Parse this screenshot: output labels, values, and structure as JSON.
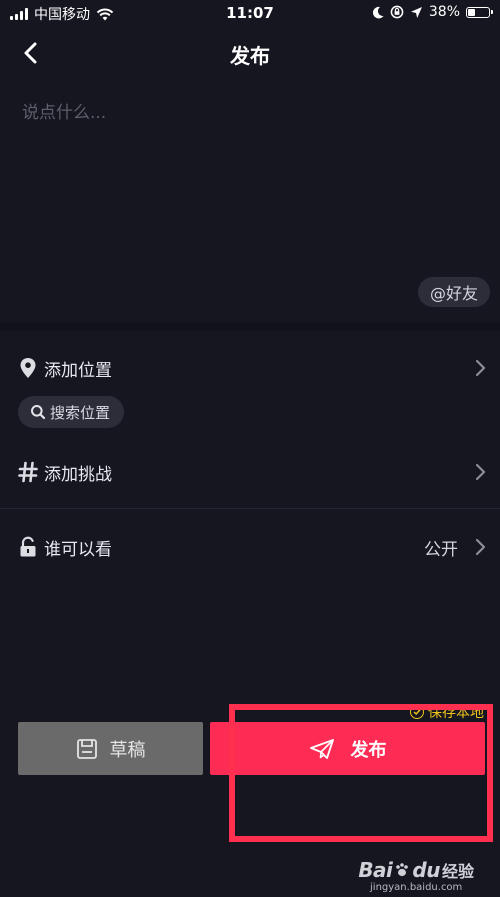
{
  "status_bar": {
    "carrier": "中国移动",
    "time": "11:07",
    "battery_percent": "38%",
    "battery_level": 0.38
  },
  "nav": {
    "title": "发布",
    "back_icon": "chevron-left-icon"
  },
  "caption": {
    "value": "",
    "placeholder": "说点什么...",
    "friends_label": "@好友"
  },
  "location": {
    "label": "添加位置",
    "icon": "location-pin-icon",
    "search_label": "搜索位置"
  },
  "challenge": {
    "label": "添加挑战",
    "icon": "hashtag-icon"
  },
  "privacy": {
    "label": "谁可以看",
    "value": "公开",
    "icon": "unlock-icon"
  },
  "bottom": {
    "save_local_label": "保存本地",
    "draft_label": "草稿",
    "publish_label": "发布"
  },
  "watermark": {
    "logo_text": "Bai",
    "logo_text_tail": "du",
    "cn_text": "经验",
    "url": "jingyan.baidu.com"
  },
  "colors": {
    "background": "#161621",
    "publish_red": "#fe2c55",
    "draft_gray": "#6a6a6a",
    "save_yellow": "#f0c419",
    "annotation_red": "#ff2f4f"
  }
}
